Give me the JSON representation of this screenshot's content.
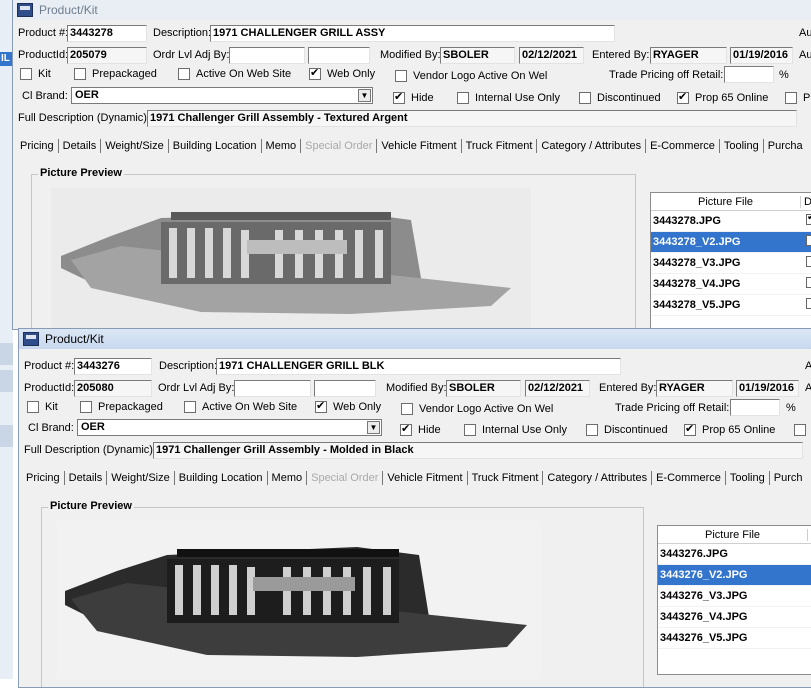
{
  "back": {
    "title": "Product/Kit",
    "product_label": "Product #:",
    "product_no": "3443278",
    "description_label": "Description:",
    "description": "1971 CHALLENGER GRILL ASSY",
    "right_edge_1": "Au",
    "productid_label": "ProductId:",
    "productid": "205079",
    "ordr_label": "Ordr Lvl Adj By:",
    "modified_label": "Modified By:",
    "modified_by": "SBOLER",
    "modified_date": "02/12/2021",
    "entered_label": "Entered By:",
    "entered_by": "RYAGER",
    "entered_date": "01/19/2016",
    "right_edge_2": "Au",
    "kit": "Kit",
    "prepackaged": "Prepackaged",
    "active_web": "Active On Web Site",
    "web_only": "Web Only",
    "vendor_logo": "Vendor Logo Active On Wel",
    "trade_pricing": "Trade Pricing off Retail:",
    "pct": "%",
    "brand_label": "Cl Brand:",
    "brand": "OER",
    "hide": "Hide",
    "internal": "Internal Use Only",
    "discontinued": "Discontinued",
    "prop65": "Prop 65 Online",
    "right_edge_3": "Pr",
    "fulldesc_label": "Full Description (Dynamic):",
    "fulldesc": "1971 Challenger Grill Assembly - Textured Argent",
    "tabs": [
      "Pricing",
      "Details",
      "Weight/Size",
      "Building Location",
      "Memo",
      "Special Order",
      "Vehicle Fitment",
      "Truck Fitment",
      "Category / Attributes",
      "E-Commerce",
      "Tooling",
      "Purcha"
    ],
    "preview_label": "Picture Preview",
    "file_header": "Picture File",
    "def_header": "Def",
    "files": [
      "3443278.JPG",
      "3443278_V2.JPG",
      "3443278_V3.JPG",
      "3443278_V4.JPG",
      "3443278_V5.JPG"
    ]
  },
  "front": {
    "title": "Product/Kit",
    "product_label": "Product #:",
    "product_no": "3443276",
    "description_label": "Description:",
    "description": "1971 CHALLENGER GRILL BLK",
    "right_edge_1": "A",
    "productid_label": "ProductId:",
    "productid": "205080",
    "ordr_label": "Ordr Lvl Adj By:",
    "modified_label": "Modified By:",
    "modified_by": "SBOLER",
    "modified_date": "02/12/2021",
    "entered_label": "Entered By:",
    "entered_by": "RYAGER",
    "entered_date": "01/19/2016",
    "right_edge_2": "A",
    "kit": "Kit",
    "prepackaged": "Prepackaged",
    "active_web": "Active On Web Site",
    "web_only": "Web Only",
    "vendor_logo": "Vendor Logo Active On Wel",
    "trade_pricing": "Trade Pricing off Retail:",
    "pct": "%",
    "brand_label": "Cl Brand:",
    "brand": "OER",
    "hide": "Hide",
    "internal": "Internal Use Only",
    "discontinued": "Discontinued",
    "prop65": "Prop 65 Online",
    "fulldesc_label": "Full Description (Dynamic):",
    "fulldesc": "1971 Challenger Grill Assembly - Molded in Black",
    "tabs": [
      "Pricing",
      "Details",
      "Weight/Size",
      "Building Location",
      "Memo",
      "Special Order",
      "Vehicle Fitment",
      "Truck Fitment",
      "Category / Attributes",
      "E-Commerce",
      "Tooling",
      "Purch"
    ],
    "preview_label": "Picture Preview",
    "file_header": "Picture File",
    "def_header": "De",
    "files": [
      "3443276.JPG",
      "3443276_V2.JPG",
      "3443276_V3.JPG",
      "3443276_V4.JPG",
      "3443276_V5.JPG"
    ]
  },
  "bg_edge_label": "IL",
  "colors": {
    "selected_row": "#3374cc",
    "title_active": "#c7d8ee"
  }
}
